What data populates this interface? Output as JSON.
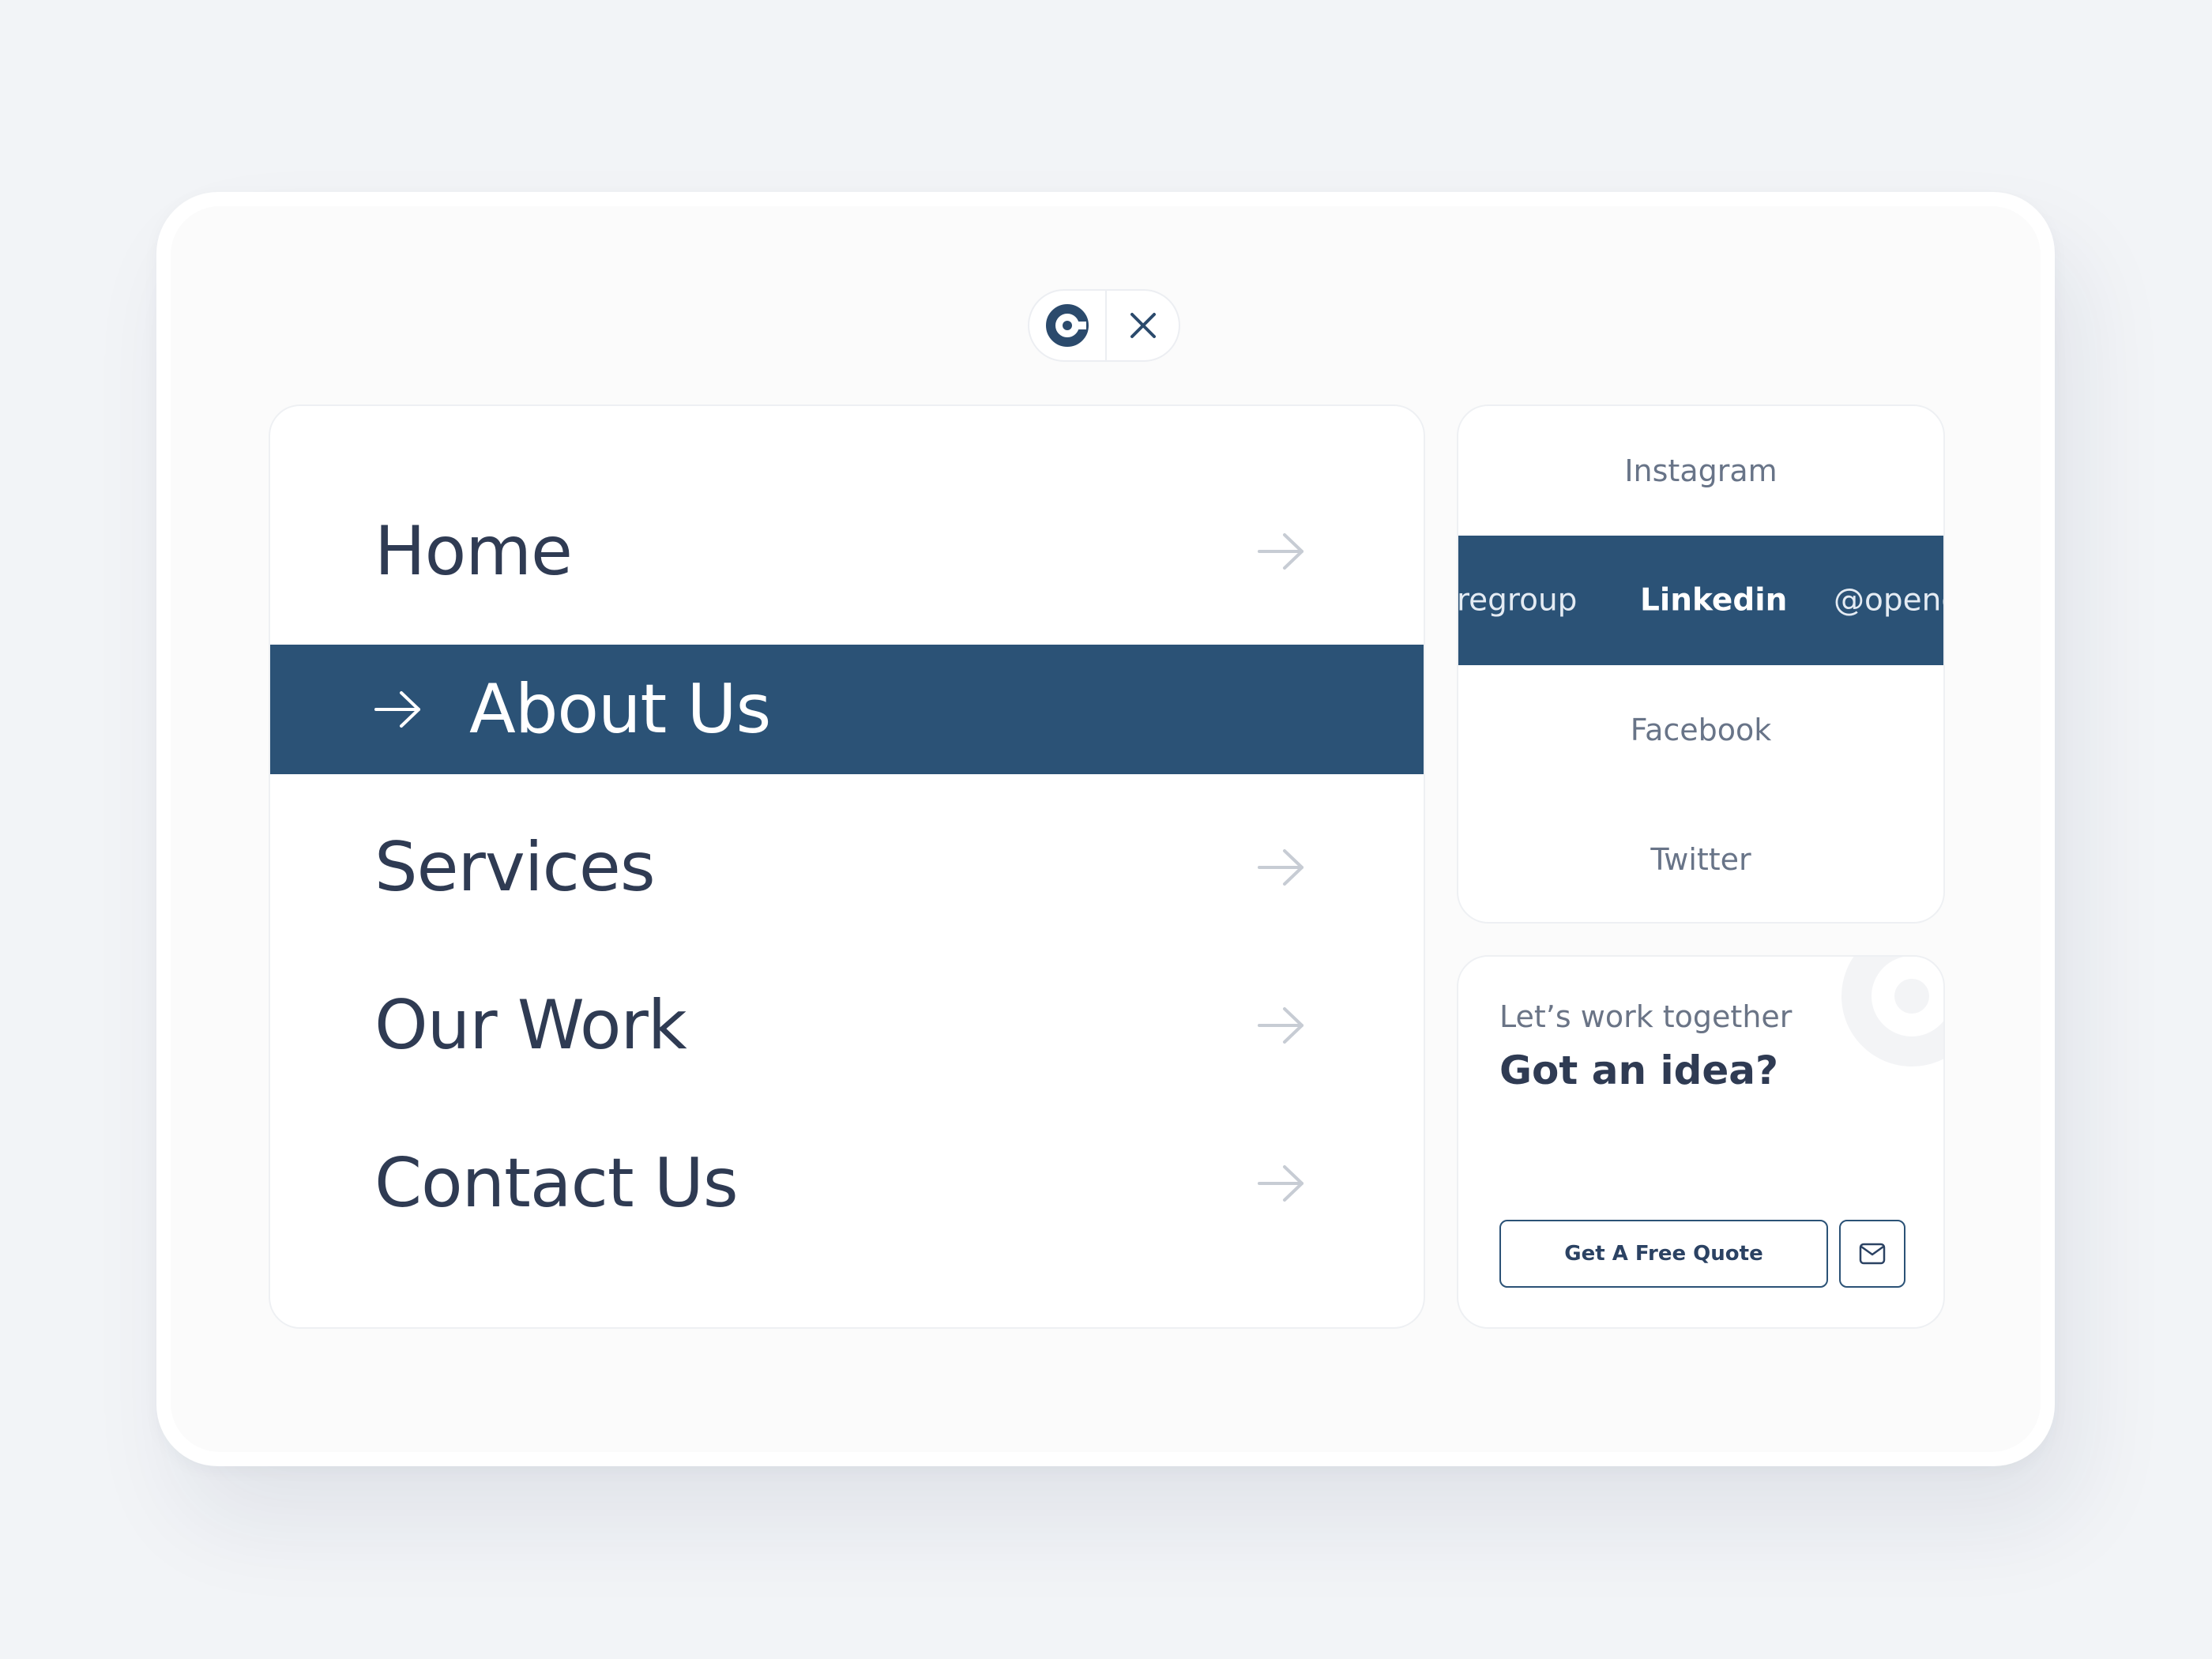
{
  "colors": {
    "accent": "#2b5276",
    "background": "#f2f4f7",
    "text_dark": "#2f3b53",
    "text_muted": "#687488",
    "arrow_muted": "#c7ccd4"
  },
  "header": {
    "logo_icon": "brand-c-logo-icon",
    "close_icon": "close-icon"
  },
  "nav": {
    "items": [
      {
        "label": "Home",
        "active": false
      },
      {
        "label": "About Us",
        "active": true
      },
      {
        "label": "Services",
        "active": false
      },
      {
        "label": "Our Work",
        "active": false
      },
      {
        "label": "Contact Us",
        "active": false
      }
    ]
  },
  "social": {
    "items": [
      {
        "label": "Instagram",
        "active": false
      },
      {
        "label": "Linkedin",
        "active": true,
        "marquee_left": "regroup",
        "marquee_right": "@openc"
      },
      {
        "label": "Facebook",
        "active": false
      },
      {
        "label": "Twitter",
        "active": false
      }
    ]
  },
  "cta": {
    "kicker": "Let’s work together",
    "title": "Got an idea?",
    "button_label": "Get A Free Quote",
    "mail_icon": "mail-icon"
  }
}
